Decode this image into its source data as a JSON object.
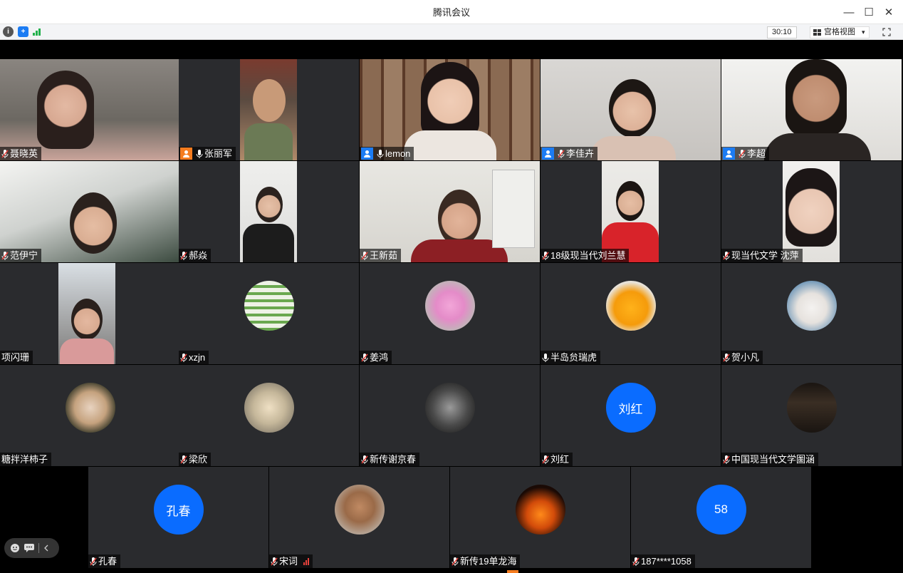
{
  "window": {
    "title": "腾讯会议",
    "minimize": "—",
    "maximize": "☐",
    "close": "✕"
  },
  "toolbar": {
    "timer": "30:10",
    "view_label": "宫格视图",
    "view_caret": "▾",
    "info_icon": "i",
    "shield_icon": "+"
  },
  "participants": [
    {
      "name": "聂晓英"
    },
    {
      "name": "张丽军"
    },
    {
      "name": "lemon"
    },
    {
      "name": "李佳卉"
    },
    {
      "name": "李超"
    },
    {
      "name": "范伊宁"
    },
    {
      "name": "郝焱"
    },
    {
      "name": "王新茹"
    },
    {
      "name": "18级现当代刘兰慧"
    },
    {
      "name": "现当代文学 沈萍"
    },
    {
      "name": "项闪珊"
    },
    {
      "name": "xzjn"
    },
    {
      "name": "姜鸿"
    },
    {
      "name": "半岛贠瑞虎"
    },
    {
      "name": "贺小凡"
    },
    {
      "name": "糖拌洋柿子"
    },
    {
      "name": "梁欣"
    },
    {
      "name": "新传谢京春"
    },
    {
      "name": "刘红",
      "avatar_text": "刘红"
    },
    {
      "name": "中国现当代文学圗涵"
    },
    {
      "name": "孔春",
      "avatar_text": "孔春"
    },
    {
      "name": "宋词"
    },
    {
      "name": "新传19单龙海"
    },
    {
      "name": "187****1058",
      "avatar_text": "58"
    }
  ],
  "colors": {
    "accent": "#0a6cff",
    "active_border": "#2eb872",
    "muted_mic": "#e8423c",
    "host_orange": "#f57c1f"
  }
}
